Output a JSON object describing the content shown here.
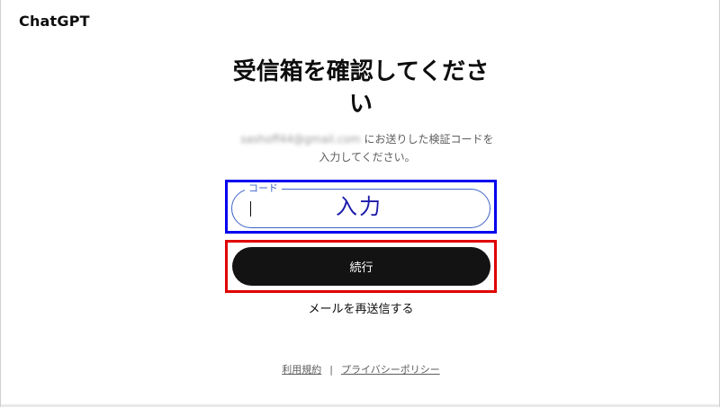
{
  "brand": {
    "name": "ChatGPT"
  },
  "heading": {
    "title": "受信箱を確認してください"
  },
  "description": {
    "email": "sashoff44@gmail.com",
    "text": "にお送りした検証コードを入力してください。"
  },
  "code_field": {
    "label": "コード",
    "value": "",
    "overlay_annotation": "入力"
  },
  "actions": {
    "continue_label": "続行",
    "resend_label": "メールを再送信する"
  },
  "footer": {
    "terms_label": "利用規約",
    "separator": "|",
    "privacy_label": "プライバシーポリシー"
  },
  "colors": {
    "highlight_input": "#0000ee",
    "highlight_button": "#e00000",
    "button_bg": "#131313",
    "field_border": "#3e63c7"
  }
}
